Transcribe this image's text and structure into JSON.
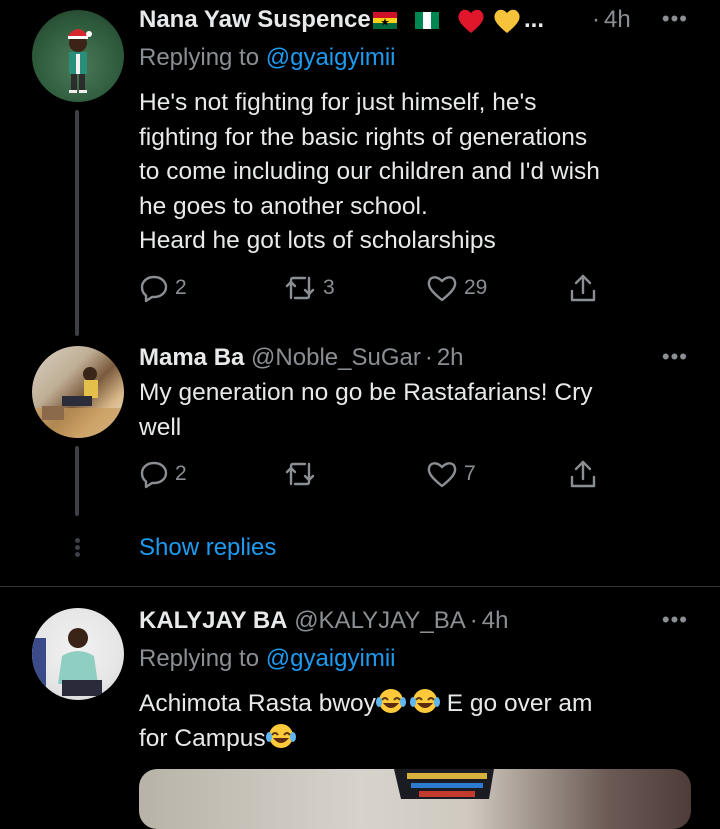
{
  "tweets": [
    {
      "name": "Nana Yaw Suspence",
      "name_emojis": [
        "ghana-flag",
        "nigeria-flag",
        "red-heart",
        "yellow-heart"
      ],
      "name_ellipsis": "...",
      "handle": "",
      "time": "4h",
      "separator": "·",
      "more": "•••",
      "replying_prefix": "Replying to",
      "replying_to": "@gyaigyimii",
      "text_lines": [
        "He's not fighting for just himself, he's",
        "fighting for the basic rights of generations",
        "to come including our children and I'd wish",
        "he goes to another school.",
        "Heard he got lots of scholarships"
      ],
      "replies": "2",
      "retweets": "3",
      "likes": "29"
    },
    {
      "name": "Mama Ba",
      "handle": "@Noble_SuGar",
      "time": "2h",
      "separator": "·",
      "more": "•••",
      "text_lines": [
        "My generation no go be Rastafarians! Cry",
        "well"
      ],
      "replies": "2",
      "retweets": "",
      "likes": "7"
    },
    {
      "name": "KALYJAY BA",
      "handle": "@KALYJAY_BA",
      "time": "4h",
      "separator": "·",
      "more": "•••",
      "replying_prefix": "Replying to",
      "replying_to": "@gyaigyimii",
      "text_segments": {
        "line1_a": "Achimota Rasta bwoy",
        "line1_b": " E go over am",
        "line2": "for Campus"
      },
      "text_emoji": "face-with-tears-of-joy"
    }
  ],
  "show_replies": "Show replies",
  "colors": {
    "background": "#000000",
    "text": "#e7e9ea",
    "secondary": "#8b8f93",
    "link": "#1d9bf0",
    "divider": "#2f3336"
  }
}
